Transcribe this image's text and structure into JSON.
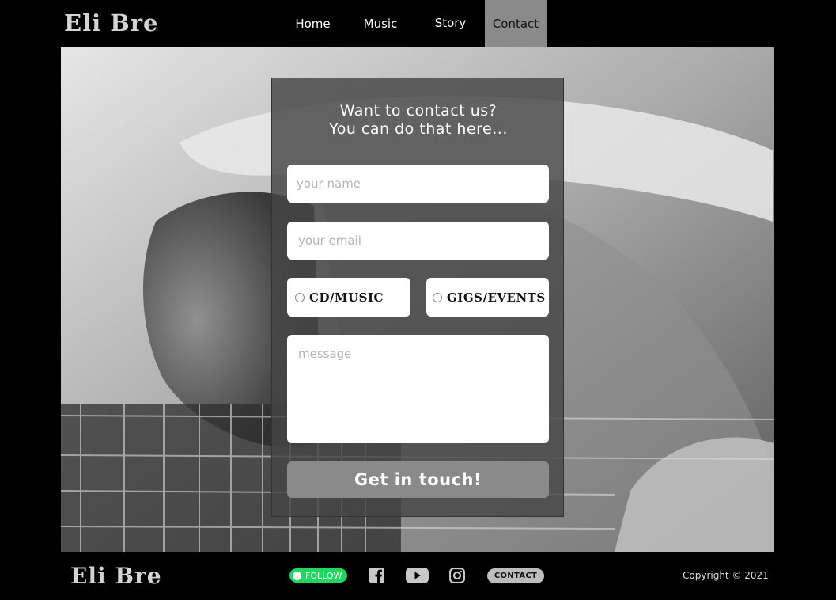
{
  "header": {
    "logo": "Eli Bre",
    "nav": [
      {
        "label": "Home"
      },
      {
        "label": "Music"
      },
      {
        "label": "Story"
      },
      {
        "label": "Contact",
        "active": true
      }
    ]
  },
  "form": {
    "title_line1": "Want to contact us?",
    "title_line2": "You can do that here...",
    "name_placeholder": "your name",
    "email_placeholder": "your email",
    "radio_options": [
      {
        "label": "CD/MUSIC"
      },
      {
        "label": "GIGS/EVENTS"
      }
    ],
    "message_placeholder": "message",
    "submit_label": "Get in touch!"
  },
  "footer": {
    "logo": "Eli Bre",
    "follow_label": "FOLLOW",
    "social_icons": [
      "facebook-icon",
      "youtube-icon",
      "instagram-icon"
    ],
    "contact_label": "CONTACT",
    "copyright": "Copyright © 2021"
  },
  "colors": {
    "background": "#000000",
    "nav_active": "#8a8a8a",
    "panel": "#464646",
    "button": "#8a8a8a",
    "follow": "#1ed760"
  }
}
